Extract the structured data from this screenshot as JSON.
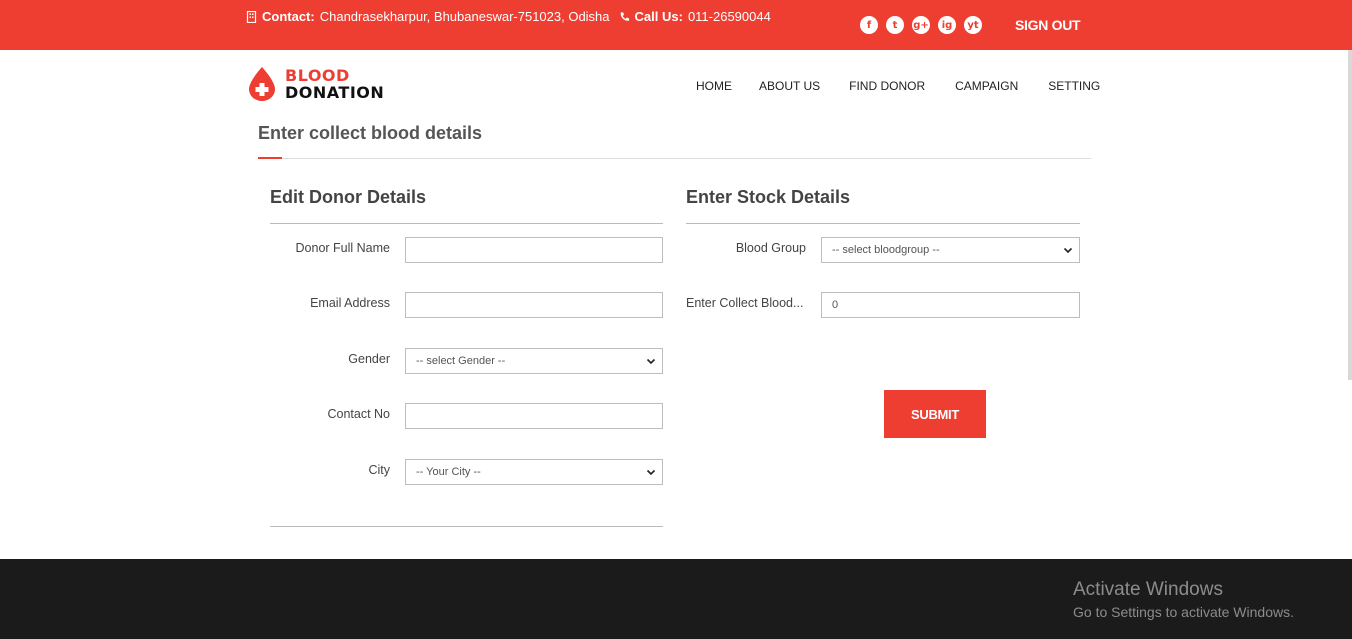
{
  "topbar": {
    "contact_label": "Contact:",
    "contact_value": "Chandrasekharpur, Bhubaneswar-751023, Odisha",
    "call_label": "Call Us:",
    "call_value": "011-26590044",
    "social": [
      "f",
      "t",
      "g+",
      "ig",
      "yt"
    ],
    "signout": "SIGN OUT",
    "color": "#ee3e32"
  },
  "logo": {
    "line1": "BLOOD",
    "line2": "DONATION"
  },
  "nav": [
    "HOME",
    "ABOUT US",
    "FIND DONOR",
    "CAMPAIGN",
    "SETTING"
  ],
  "page_title": "Enter collect blood details",
  "donor": {
    "heading": "Edit Donor Details",
    "name_label": "Donor Full Name",
    "name_value": "",
    "email_label": "Email Address",
    "email_value": "",
    "gender_label": "Gender",
    "gender_value": "-- select Gender --",
    "contact_label": "Contact No",
    "contact_value": "",
    "city_label": "City",
    "city_value": "-- Your City --"
  },
  "stock": {
    "heading": "Enter Stock Details",
    "group_label": "Blood Group",
    "group_value": "-- select bloodgroup --",
    "collect_label": "Enter Collect Blood...",
    "collect_value": "0",
    "submit": "SUBMIT"
  },
  "watermark": {
    "title": "Activate Windows",
    "subtitle": "Go to Settings to activate Windows."
  }
}
